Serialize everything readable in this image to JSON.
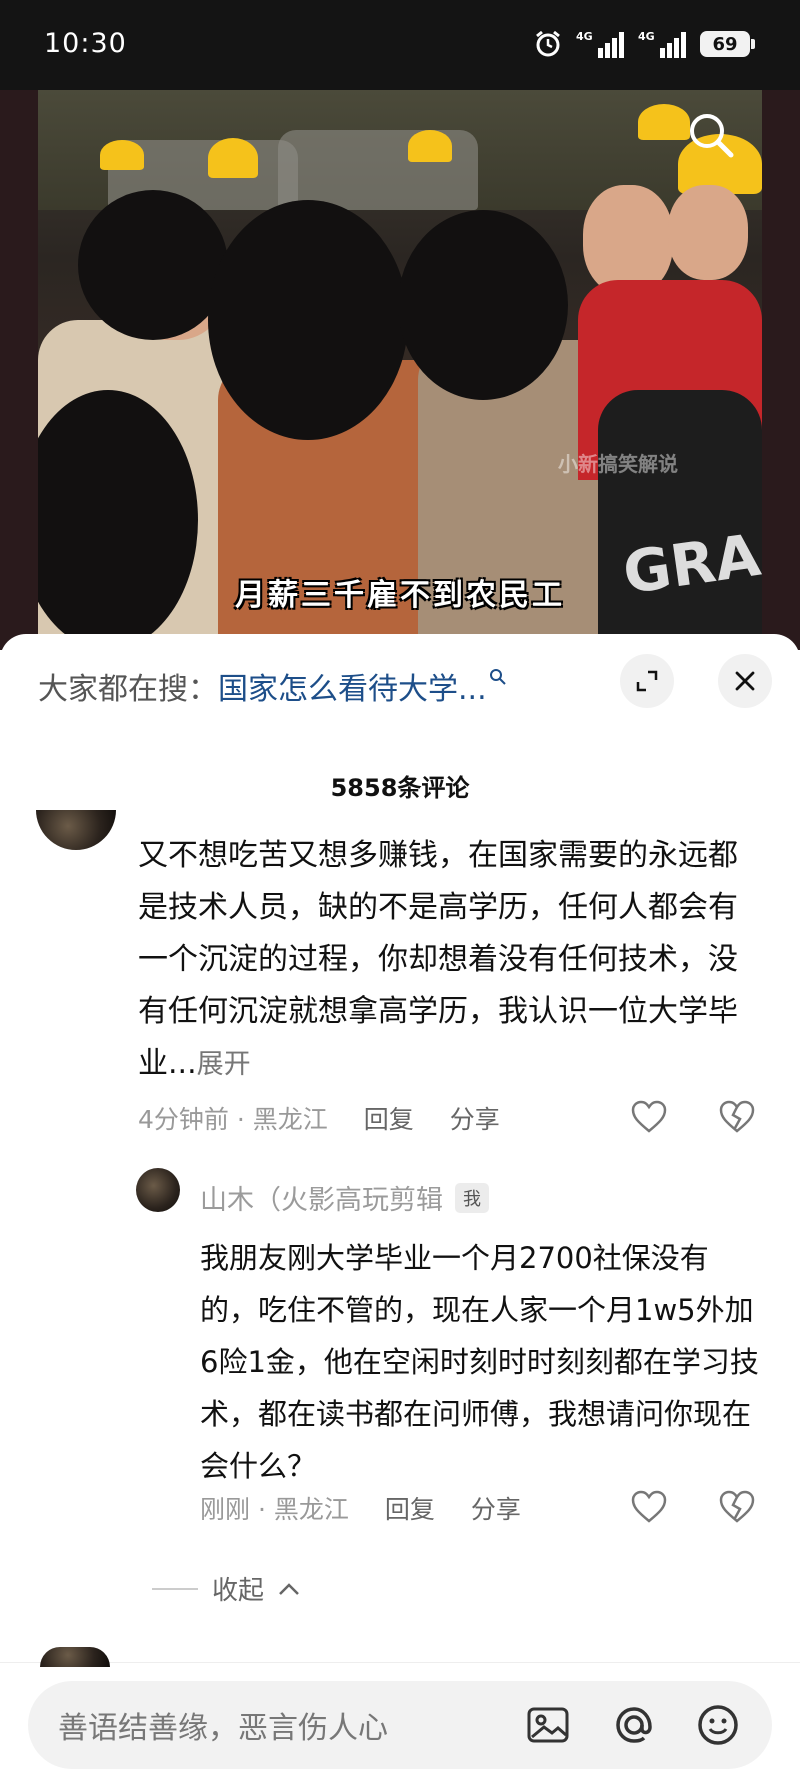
{
  "status_bar": {
    "time": "10:30",
    "signal_label_1": "4G",
    "signal_label_2": "4G",
    "battery": "69"
  },
  "video": {
    "subtitle": "月薪三千雇不到农民工",
    "watermark": "小新搞笑解说",
    "shirt_text": "GRA"
  },
  "search_bar": {
    "prefix": "大家都在搜：",
    "query": "国家怎么看待大学..."
  },
  "comments_header": {
    "count_label": "5858条评论"
  },
  "comment": {
    "text": "又不想吃苦又想多赚钱，在国家需要的永远都是技术人员，缺的不是高学历，任何人都会有一个沉淀的过程，你却想着没有任何技术，没有任何沉淀就想拿高学历，我认识一位大学毕业...",
    "expand_label": "展开",
    "time_location": "4分钟前 · 黑龙江",
    "reply_label": "回复",
    "share_label": "分享"
  },
  "reply": {
    "username": "山木（火影高玩剪辑",
    "badge": "我",
    "text": "我朋友刚大学毕业一个月2700社保没有的，吃住不管的，现在人家一个月1w5外加6险1金，他在空闲时刻时时刻刻都在学习技术，都在读书都在问师傅，我想请问你现在会什么？",
    "time_location": "刚刚 · 黑龙江",
    "reply_label": "回复",
    "share_label": "分享"
  },
  "collapse": {
    "label": "收起"
  },
  "bottom_input": {
    "placeholder": "善语结善缘，恶言伤人心"
  },
  "icons": {
    "search": "search-icon",
    "expand": "expand-icon",
    "close": "close-icon",
    "like": "heart-icon",
    "dislike": "broken-heart-icon",
    "image": "image-icon",
    "mention": "at-icon",
    "emoji": "emoji-icon"
  },
  "colors": {
    "accent_query": "#1d4e89",
    "helmet": "#f5c21b"
  }
}
